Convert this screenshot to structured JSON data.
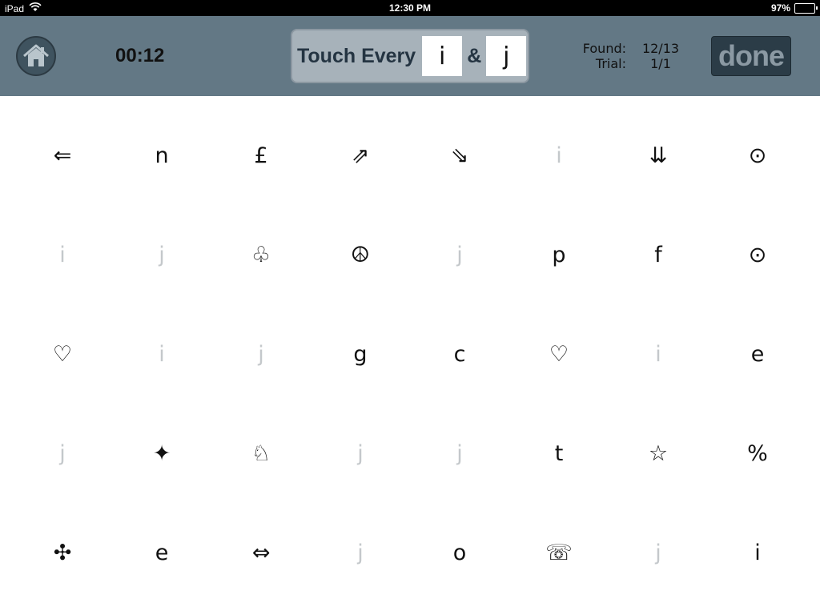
{
  "status_bar": {
    "device": "iPad",
    "time": "12:30 PM",
    "battery": "97%",
    "battery_level": 0.97,
    "wifi_icon": "wifi-icon"
  },
  "header": {
    "home_icon": "home-icon",
    "timer": "00:12",
    "instruction": {
      "label": "Touch Every",
      "target1": "i",
      "conjunction": "&",
      "target2": "j"
    },
    "stats": {
      "found_label": "Found:",
      "found_value": "12/13",
      "trial_label": "Trial:",
      "trial_value": "1/1"
    },
    "done_label": "done"
  },
  "grid": [
    {
      "symbol": "⇐",
      "found": false
    },
    {
      "symbol": "n",
      "found": false
    },
    {
      "symbol": "£",
      "found": false
    },
    {
      "symbol": "⇗",
      "found": false
    },
    {
      "symbol": "⇘",
      "found": false
    },
    {
      "symbol": "i",
      "found": true
    },
    {
      "symbol": "⇊",
      "found": false
    },
    {
      "symbol": "⊙",
      "found": false
    },
    {
      "symbol": "i",
      "found": true
    },
    {
      "symbol": "j",
      "found": true
    },
    {
      "symbol": "♧",
      "found": false
    },
    {
      "symbol": "☮",
      "found": false
    },
    {
      "symbol": "j",
      "found": true
    },
    {
      "symbol": "p",
      "found": false
    },
    {
      "symbol": "f",
      "found": false
    },
    {
      "symbol": "⊙",
      "found": false
    },
    {
      "symbol": "♡",
      "found": false
    },
    {
      "symbol": "i",
      "found": true
    },
    {
      "symbol": "j",
      "found": true
    },
    {
      "symbol": "g",
      "found": false
    },
    {
      "symbol": "c",
      "found": false
    },
    {
      "symbol": "♡",
      "found": false
    },
    {
      "symbol": "i",
      "found": true
    },
    {
      "symbol": "e",
      "found": false
    },
    {
      "symbol": "j",
      "found": true
    },
    {
      "symbol": "✦",
      "found": false
    },
    {
      "symbol": "♘",
      "found": false
    },
    {
      "symbol": "j",
      "found": true
    },
    {
      "symbol": "j",
      "found": true
    },
    {
      "symbol": "t",
      "found": false
    },
    {
      "symbol": "☆",
      "found": false
    },
    {
      "symbol": "%",
      "found": false
    },
    {
      "symbol": "✣",
      "found": false
    },
    {
      "symbol": "e",
      "found": false
    },
    {
      "symbol": "⇔",
      "found": false
    },
    {
      "symbol": "j",
      "found": true
    },
    {
      "symbol": "o",
      "found": false
    },
    {
      "symbol": "☏",
      "found": false
    },
    {
      "symbol": "j",
      "found": true
    },
    {
      "symbol": "i",
      "found": false
    }
  ]
}
